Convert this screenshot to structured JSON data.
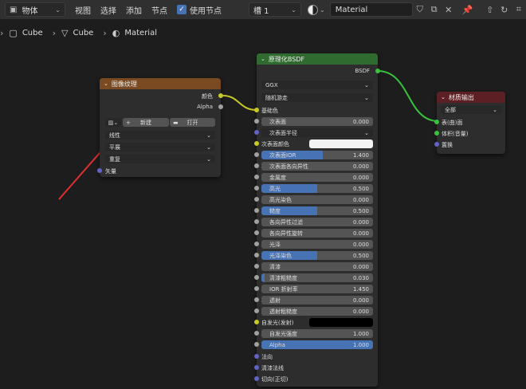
{
  "header": {
    "mode": "物体",
    "menus": [
      "视图",
      "选择",
      "添加",
      "节点"
    ],
    "use_nodes_label": "使用节点",
    "slot": "槽 1",
    "material_name": "Material"
  },
  "breadcrumb": {
    "items": [
      "Cube",
      "Cube",
      "Material"
    ]
  },
  "image_texture_node": {
    "title": "图像纹理",
    "outputs": [
      "颜色",
      "Alpha"
    ],
    "new_button": "新建",
    "open_button": "打开",
    "interpolation": "线性",
    "projection": "平展",
    "extension": "重复",
    "input": "矢量"
  },
  "bsdf_node": {
    "title": "原理化BSDF",
    "output": "BSDF",
    "distribution": "GGX",
    "subsurface_method": "随机游走",
    "base_color_label": "基础色",
    "subsurface_label": "次表面",
    "subsurface_value": "0.000",
    "subsurface_radius_label": "次表面半径",
    "subsurface_color_label": "次表面颜色",
    "fields": [
      {
        "label": "次表面IOR",
        "value": "1.400",
        "fill": 0.55
      },
      {
        "label": "次表面各向异性",
        "value": "0.000",
        "fill": 0
      },
      {
        "label": "金属度",
        "value": "0.000",
        "fill": 0
      },
      {
        "label": "高光",
        "value": "0.500",
        "fill": 0.5
      },
      {
        "label": "高光染色",
        "value": "0.000",
        "fill": 0
      },
      {
        "label": "糙度",
        "value": "0.500",
        "fill": 0.5
      },
      {
        "label": "各向异性过滤",
        "value": "0.000",
        "fill": 0
      },
      {
        "label": "各向异性旋转",
        "value": "0.000",
        "fill": 0
      },
      {
        "label": "光泽",
        "value": "0.000",
        "fill": 0
      },
      {
        "label": "光泽染色",
        "value": "0.500",
        "fill": 0.5
      },
      {
        "label": "清漆",
        "value": "0.000",
        "fill": 0
      },
      {
        "label": "清漆粗糙度",
        "value": "0.030",
        "fill": 0.03
      },
      {
        "label": "IOR 折射率",
        "value": "1.450",
        "fill": 0
      },
      {
        "label": "透射",
        "value": "0.000",
        "fill": 0
      },
      {
        "label": "透射粗糙度",
        "value": "0.000",
        "fill": 0
      }
    ],
    "emission_label": "自发光(发射)",
    "emission_strength_label": "自发光强度",
    "emission_strength_value": "1.000",
    "alpha_label": "Alpha",
    "alpha_value": "1.000",
    "inputs_bottom": [
      "法向",
      "清漆法线",
      "切向(正切)"
    ]
  },
  "output_node": {
    "title": "材质输出",
    "target": "全部",
    "inputs": [
      "表(曲)面",
      "体积(音量)",
      "置换"
    ]
  },
  "colors": {
    "texture_header": "#7a4a22",
    "shader_header": "#2f6b2f",
    "output_header": "#5c1f24",
    "annotation": "#e03030"
  }
}
